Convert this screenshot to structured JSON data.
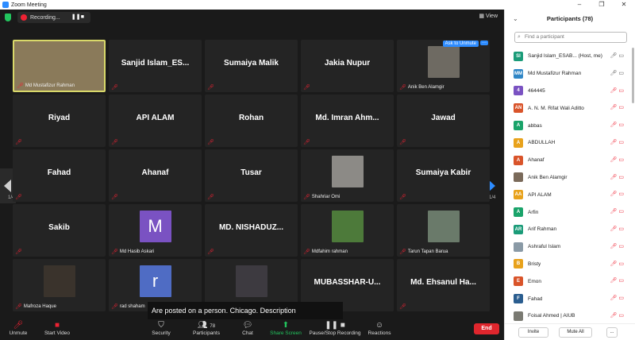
{
  "window": {
    "title": "Zoom Meeting",
    "controls": [
      "–",
      "❐",
      "✕"
    ]
  },
  "topbar": {
    "recording_label": "Recording...",
    "view_label": "View"
  },
  "tiles": [
    {
      "name": "Md Mustafizur Rahman",
      "caption": "Md Mustafizur Rahman",
      "kind": "video",
      "active": true,
      "color": "#8a7a5a"
    },
    {
      "name": "Sanjid  Islam_ES...",
      "caption": "",
      "kind": "name"
    },
    {
      "name": "Sumaiya Malik",
      "caption": "",
      "kind": "name"
    },
    {
      "name": "Jakia Nupur",
      "caption": "",
      "kind": "name"
    },
    {
      "name": "",
      "caption": "Anik Ben Alamgir",
      "kind": "photo",
      "color": "#6e6a62",
      "ask": true
    },
    {
      "name": "Riyad",
      "caption": "",
      "kind": "name"
    },
    {
      "name": "API ALAM",
      "caption": "",
      "kind": "name"
    },
    {
      "name": "Rohan",
      "caption": "",
      "kind": "name"
    },
    {
      "name": "Md. Imran Ahm...",
      "caption": "",
      "kind": "name"
    },
    {
      "name": "Jawad",
      "caption": "",
      "kind": "name"
    },
    {
      "name": "Fahad",
      "caption": "",
      "kind": "name"
    },
    {
      "name": "Ahanaf",
      "caption": "",
      "kind": "name"
    },
    {
      "name": "Tusar",
      "caption": "",
      "kind": "name"
    },
    {
      "name": "",
      "caption": "Shahriar Omi",
      "kind": "photo",
      "color": "#8c8a86"
    },
    {
      "name": "Sumaiya Kabir",
      "caption": "",
      "kind": "name"
    },
    {
      "name": "Sakib",
      "caption": "",
      "kind": "name"
    },
    {
      "name": "",
      "caption": "Md Hasib Askari",
      "kind": "letter",
      "letter": "M",
      "color": "#7a52c2"
    },
    {
      "name": "MD. NISHADUZ...",
      "caption": "",
      "kind": "name"
    },
    {
      "name": "",
      "caption": "Mdfahim rahman",
      "kind": "photo",
      "color": "#4d7a3a"
    },
    {
      "name": "",
      "caption": "Tarun Tapan Barua",
      "kind": "photo",
      "color": "#6a7a6a"
    },
    {
      "name": "",
      "caption": "Mafroza Haque",
      "kind": "photo",
      "color": "#3a332c"
    },
    {
      "name": "",
      "caption": "rad shaham",
      "kind": "letter",
      "letter": "r",
      "color": "#4f6cc4"
    },
    {
      "name": "",
      "caption": "",
      "kind": "photo",
      "color": "#3d3a40"
    },
    {
      "name": "MUBASSHAR-U...",
      "caption": "",
      "kind": "name"
    },
    {
      "name": "Md. Ehsanul Ha...",
      "caption": "",
      "kind": "name"
    }
  ],
  "ask_to_unmute": "Ask to Unmute",
  "ask_more": "···",
  "pager": {
    "left": "1/4",
    "right": "1/4"
  },
  "subtitle": "Are posted on a person. Chicago. Description",
  "toolbar": {
    "unmute": "Unmute",
    "start_video": "Start Video",
    "security": "Security",
    "participants": "Participants",
    "participants_count": "78",
    "chat": "Chat",
    "share_screen": "Share Screen",
    "pause_recording": "Pause/Stop Recording",
    "reactions": "Reactions",
    "end": "End"
  },
  "panel": {
    "title": "Participants (78)",
    "search_placeholder": "Find a participant",
    "participants": [
      {
        "initials": "SI",
        "color": "#1a9b78",
        "name": "Sanjid Islam_ESAB... (Host, me)",
        "icons": "gray"
      },
      {
        "initials": "MM",
        "color": "#2f86c6",
        "name": "Md Mustafizur Rahman",
        "icons": "gray"
      },
      {
        "initials": "4",
        "color": "#7a52c2",
        "name": "464445",
        "icons": "red"
      },
      {
        "initials": "AN",
        "color": "#d9542a",
        "name": "A. N. M. Rifat Wali Aditto",
        "icons": "red"
      },
      {
        "initials": "A",
        "color": "#1aa36a",
        "name": "abbas",
        "icons": "red"
      },
      {
        "initials": "A",
        "color": "#e8a21c",
        "name": "ABDULLAH",
        "icons": "red"
      },
      {
        "initials": "A",
        "color": "#d9542a",
        "name": "Ahanaf",
        "icons": "red"
      },
      {
        "initials": "",
        "color": "#7a6a5a",
        "name": "Anik Ben Alamgir",
        "icons": "red"
      },
      {
        "initials": "AA",
        "color": "#e8a21c",
        "name": "API ALAM",
        "icons": "red"
      },
      {
        "initials": "A",
        "color": "#1aa36a",
        "name": "Arfin",
        "icons": "red"
      },
      {
        "initials": "AR",
        "color": "#1a9b78",
        "name": "Arif Rahman",
        "icons": "red"
      },
      {
        "initials": "",
        "color": "#8a9aa6",
        "name": "Ashraful Islam",
        "icons": "red"
      },
      {
        "initials": "B",
        "color": "#e8a21c",
        "name": "Bristy",
        "icons": "red"
      },
      {
        "initials": "E",
        "color": "#d9542a",
        "name": "Emon",
        "icons": "red"
      },
      {
        "initials": "F",
        "color": "#2a5d8f",
        "name": "Fahad",
        "icons": "red"
      },
      {
        "initials": "",
        "color": "#7a7a72",
        "name": "Foisal Ahmed | AIUB",
        "icons": "red"
      }
    ],
    "invite": "Invite",
    "mute_all": "Mute All",
    "more": "..."
  }
}
